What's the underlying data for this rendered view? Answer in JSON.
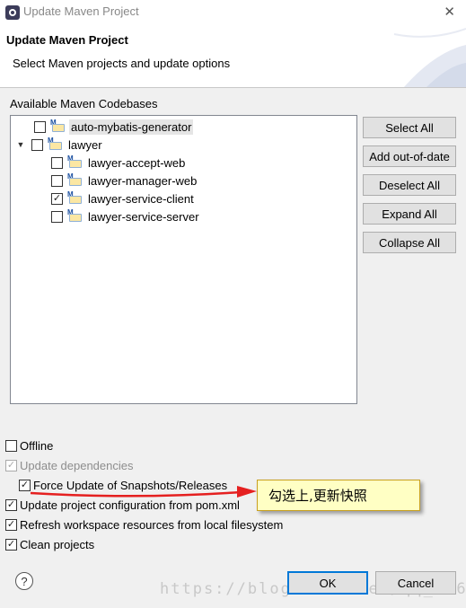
{
  "window": {
    "title": "Update Maven Project",
    "close_glyph": "✕"
  },
  "header": {
    "title": "Update Maven Project",
    "subtitle": "Select Maven projects and update options"
  },
  "codebases": {
    "label": "Available Maven Codebases",
    "items": [
      {
        "label": "auto-mybatis-generator",
        "checked": false,
        "expanded": null,
        "selected": true,
        "level": 0
      },
      {
        "label": "lawyer",
        "checked": false,
        "expanded": true,
        "selected": false,
        "level": 0
      },
      {
        "label": "lawyer-accept-web",
        "checked": false,
        "expanded": null,
        "selected": false,
        "level": 1
      },
      {
        "label": "lawyer-manager-web",
        "checked": false,
        "expanded": null,
        "selected": false,
        "level": 1
      },
      {
        "label": "lawyer-service-client",
        "checked": true,
        "expanded": null,
        "selected": false,
        "level": 1
      },
      {
        "label": "lawyer-service-server",
        "checked": false,
        "expanded": null,
        "selected": false,
        "level": 1
      }
    ]
  },
  "side_buttons": {
    "select_all": "Select All",
    "add_out_of_date": "Add out-of-date",
    "deselect_all": "Deselect All",
    "expand_all": "Expand All",
    "collapse_all": "Collapse All"
  },
  "options": {
    "offline": {
      "label": "Offline",
      "checked": false
    },
    "update_dependencies": {
      "label": "Update dependencies",
      "checked": true,
      "disabled": true
    },
    "force_update": {
      "label": "Force Update of Snapshots/Releases",
      "checked": true
    },
    "update_config": {
      "label": "Update project configuration from pom.xml",
      "checked": true
    },
    "refresh_workspace": {
      "label": "Refresh workspace resources from local filesystem",
      "checked": true
    },
    "clean_projects": {
      "label": "Clean projects",
      "checked": true
    }
  },
  "annotation": {
    "text": "勾选上,更新快照",
    "arrow_color": "#e52020"
  },
  "footer": {
    "help_glyph": "?",
    "ok": "OK",
    "cancel": "Cancel"
  },
  "watermark": "https://blog.csdn.net/qq_31698847",
  "check_glyph": "✓"
}
